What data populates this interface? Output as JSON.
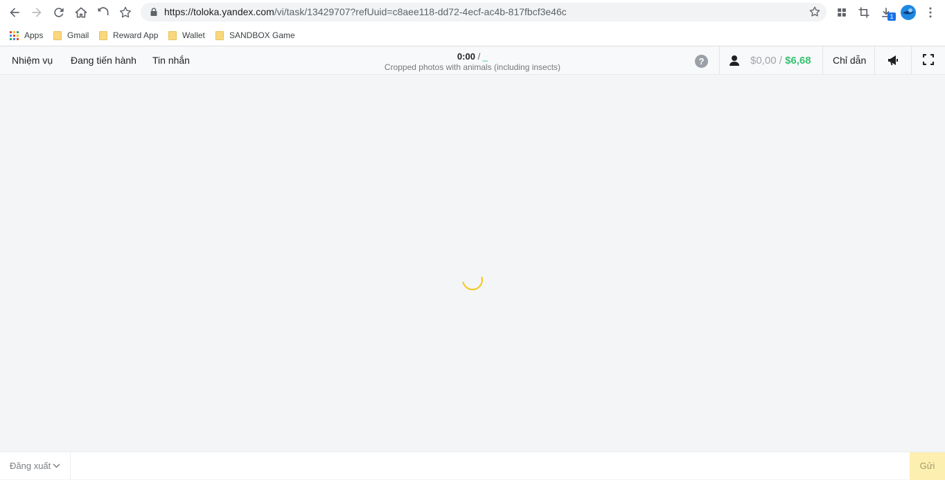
{
  "browser": {
    "url_host": "https://toloka.yandex.com",
    "url_path": "/vi/task/13429707?refUuid=c8aee118-dd72-4ecf-ac4b-817fbcf3e46c",
    "download_badge": "1",
    "bookmarks": [
      {
        "label": "Apps",
        "icon": "apps-grid-icon"
      },
      {
        "label": "Gmail",
        "icon": "folder-icon"
      },
      {
        "label": "Reward App",
        "icon": "folder-icon"
      },
      {
        "label": "Wallet",
        "icon": "folder-icon"
      },
      {
        "label": "SANDBOX Game",
        "icon": "folder-icon"
      }
    ]
  },
  "header": {
    "menu": [
      "Nhiệm vụ",
      "Đang tiến hành",
      "Tin nhắn"
    ],
    "timer": "0:00",
    "timer_sep": "/",
    "timer_limit": "_",
    "task_title": "Cropped photos with animals (including insects)",
    "help_label": "?",
    "earnings_current": "$0,00",
    "earnings_sep": "/",
    "earnings_total": "$6,68",
    "guide_label": "Chỉ dẫn"
  },
  "footer": {
    "logout_label": "Đăng xuất",
    "submit_label": "Gửi"
  },
  "colors": {
    "accent_green": "#38c172",
    "spinner_yellow": "#f5c518",
    "submit_bg": "#fcefb0"
  }
}
